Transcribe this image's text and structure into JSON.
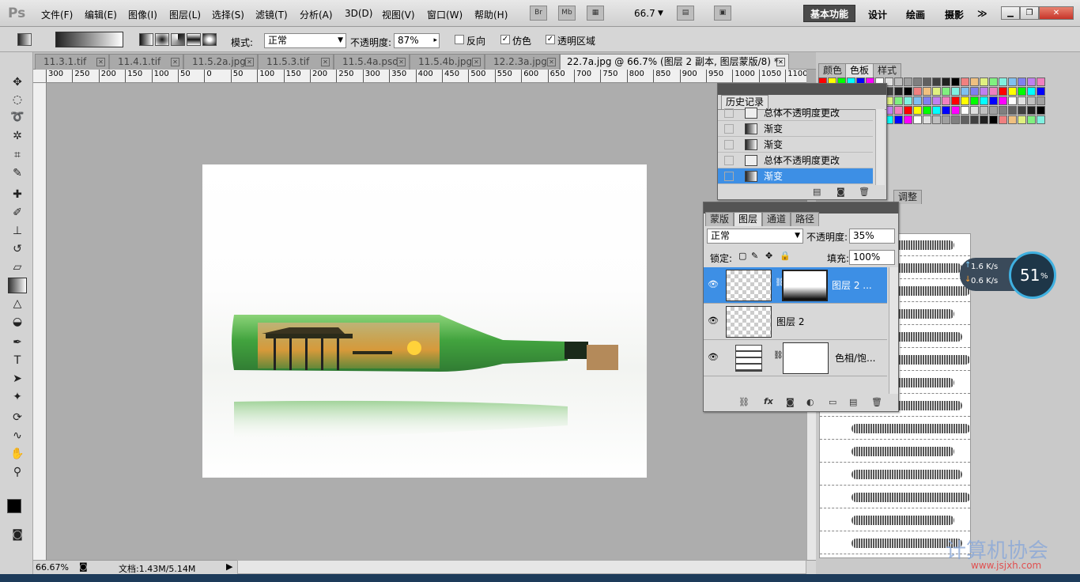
{
  "menubar": {
    "logo": "Ps",
    "items": [
      "文件(F)",
      "编辑(E)",
      "图像(I)",
      "图层(L)",
      "选择(S)",
      "滤镜(T)",
      "分析(A)",
      "3D(D)",
      "视图(V)",
      "窗口(W)",
      "帮助(H)"
    ],
    "bridge": "Br",
    "minibridge": "Mb",
    "zoom": "66.7",
    "workspaces": {
      "active": "基本功能",
      "others": [
        "设计",
        "绘画",
        "摄影"
      ],
      "more": "≫"
    }
  },
  "options": {
    "mode_label": "模式:",
    "mode_value": "正常",
    "opacity_label": "不透明度:",
    "opacity_value": "87%",
    "reverse": "反向",
    "dither": "仿色",
    "transparency": "透明区域"
  },
  "tabs": [
    {
      "label": "11.3.1.tif"
    },
    {
      "label": "11.4.1.tif"
    },
    {
      "label": "11.5.2a.jpg"
    },
    {
      "label": "11.5.3.tif"
    },
    {
      "label": "11.5.4a.psd"
    },
    {
      "label": "11.5.4b.jpg"
    },
    {
      "label": "12.2.3a.jpg"
    },
    {
      "label": "22.7a.jpg @ 66.7% (图层 2 副本, 图层蒙版/8) *"
    }
  ],
  "ruler": [
    "300",
    "250",
    "200",
    "150",
    "100",
    "50",
    "0",
    "50",
    "100",
    "150",
    "200",
    "250",
    "300",
    "350",
    "400",
    "450",
    "500",
    "550",
    "600",
    "650",
    "700",
    "750",
    "800",
    "850",
    "900",
    "950",
    "1000",
    "1050",
    "1100"
  ],
  "status": {
    "zoom": "66.67%",
    "doc": "文档:1.43M/5.14M"
  },
  "swatches_panel": {
    "tabs": [
      "颜色",
      "色板",
      "样式"
    ]
  },
  "history": {
    "title": "历史记录",
    "items": [
      {
        "label": "总体不透明度更改",
        "icon": "document-icon"
      },
      {
        "label": "渐变",
        "icon": "gradient-icon"
      },
      {
        "label": "渐变",
        "icon": "gradient-icon"
      },
      {
        "label": "总体不透明度更改",
        "icon": "document-icon"
      },
      {
        "label": "渐变",
        "icon": "gradient-icon",
        "selected": true
      }
    ]
  },
  "layers": {
    "tabs": [
      "蒙版",
      "图层",
      "通道",
      "路径"
    ],
    "blend": "正常",
    "opacity_label": "不透明度:",
    "opacity": "35%",
    "lock_label": "锁定:",
    "fill_label": "填充:",
    "fill": "100%",
    "rows": [
      {
        "name": "图层 2 ...",
        "selected": true
      },
      {
        "name": "图层 2"
      },
      {
        "name": "色相/饱..."
      }
    ]
  },
  "adjust_tab": "调整",
  "net": {
    "up": "1.6 K/s",
    "down": "0.6 K/s",
    "percent": "51",
    "unit": "%"
  },
  "watermark": {
    "text": "计算机协会",
    "url": "www.jsjxh.com"
  }
}
